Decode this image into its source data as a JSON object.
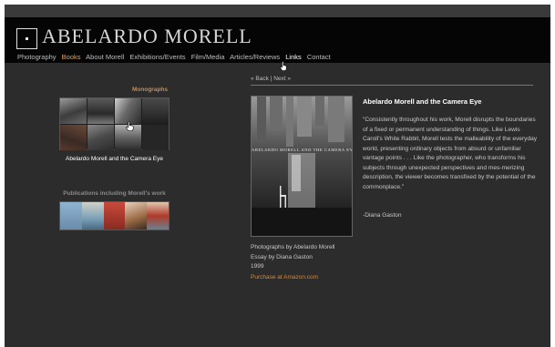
{
  "site": {
    "title": "ABELARDO MORELL"
  },
  "nav": {
    "items": [
      {
        "label": "Photography",
        "state": "normal"
      },
      {
        "label": "Books",
        "state": "active"
      },
      {
        "label": "About Morell",
        "state": "normal"
      },
      {
        "label": "Exhibitions/Events",
        "state": "normal"
      },
      {
        "label": "Film/Media",
        "state": "normal"
      },
      {
        "label": "Articles/Reviews",
        "state": "normal"
      },
      {
        "label": "Links",
        "state": "hovered"
      },
      {
        "label": "Contact",
        "state": "normal"
      }
    ]
  },
  "sidebar": {
    "monographs_heading": "Monographs",
    "selected_caption": "Abelardo Morell and the Camera Eye",
    "publications_heading": "Publications including Morell's work",
    "thumbnail_count": 8,
    "publication_count": 5
  },
  "pager": {
    "back": "« Back",
    "separator": "|",
    "next": "Next »"
  },
  "book": {
    "cover_title": "ABELARDO MORELL AND THE CAMERA EYE",
    "title": "Abelardo Morell and the Camera Eye",
    "quote": "\"Consistently throughout his work, Morell disrupts the boundaries of a fixed or permanent understanding of things. Like Lewis Caroll's White Rabbit, Morell tests the malleability of the everyday world, presenting ordinary objects from absurd or unfamiliar vantage points . . . Like the photographer, who transforms his subjects through unexpected perspectives and mes-merizing description, the viewer becomes transfixed by the potential of the commonplace.\"",
    "quote_author": "-Diana Gaston",
    "meta": {
      "photographs_by": "Photographs by Abelardo Morell",
      "essay_by": "Essay by Diana Gaston",
      "year": "1999"
    },
    "purchase_label": "Purchase at Amazon.com"
  },
  "colors": {
    "background": "#2c2c2c",
    "header": "#050505",
    "accent": "#d28a3c",
    "text": "#c8c8c8"
  }
}
